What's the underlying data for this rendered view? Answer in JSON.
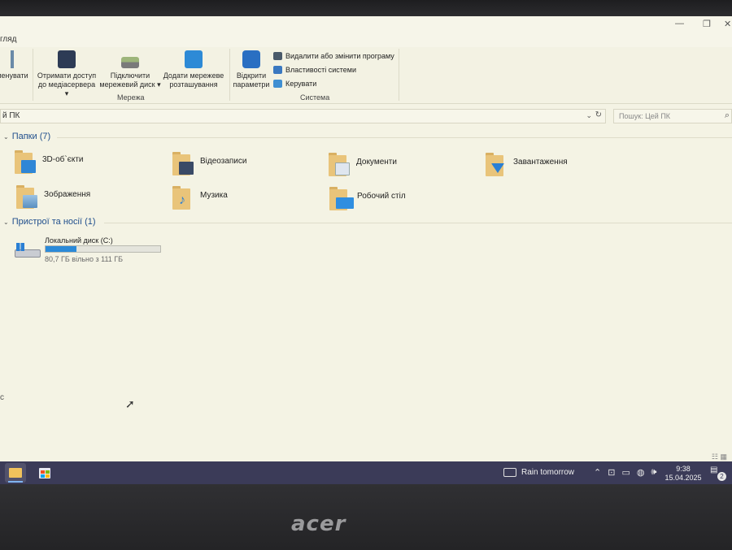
{
  "window": {
    "minimize": "—",
    "maximize": "❐",
    "close": "✕"
  },
  "menu": {
    "tab_partial": "гляд"
  },
  "ribbon": {
    "partial_button": "менувати",
    "buttons": [
      {
        "line1": "Отримати доступ",
        "line2": "до медіасервера ▾"
      },
      {
        "line1": "Підключити",
        "line2": "мережевий диск ▾"
      },
      {
        "line1": "Додати мережеве",
        "line2": "розташування"
      },
      {
        "line1": "Відкрити",
        "line2": "параметри"
      }
    ],
    "system_items": [
      "Видалити або змінити програму",
      "Властивості системи",
      "Керувати"
    ],
    "group_network": "Мережа",
    "group_system": "Система"
  },
  "address": {
    "path": "й ПК",
    "search_placeholder": "Пошук: Цей ПК"
  },
  "folders_section": {
    "title": "Папки (7)",
    "items": [
      {
        "label": "3D-об`єкти",
        "icon": "3d-objects-icon",
        "color": "#2f86d6"
      },
      {
        "label": "Відеозаписи",
        "icon": "videos-icon",
        "color": "#3a4a66"
      },
      {
        "label": "Документи",
        "icon": "documents-icon",
        "color": "#dfe6ef"
      },
      {
        "label": "Завантаження",
        "icon": "downloads-icon",
        "color": "#2a7fd4"
      },
      {
        "label": "Зображення",
        "icon": "pictures-icon",
        "color": "#5a8fc0"
      },
      {
        "label": "Музика",
        "icon": "music-icon",
        "color": "#2a7fd4"
      },
      {
        "label": "Робочий стіл",
        "icon": "desktop-icon",
        "color": "#2f8ee0"
      }
    ]
  },
  "devices_section": {
    "title": "Пристрої та носії (1)",
    "drive": {
      "name": "Локальний диск (C:)",
      "free_text": "80,7 ГБ вільно з 111 ГБ",
      "used_fraction": 0.27
    }
  },
  "left_edge_char": "с",
  "taskbar": {
    "weather": "Rain tomorrow",
    "time": "9:38",
    "date": "15.04.2025",
    "notifications": "2"
  }
}
